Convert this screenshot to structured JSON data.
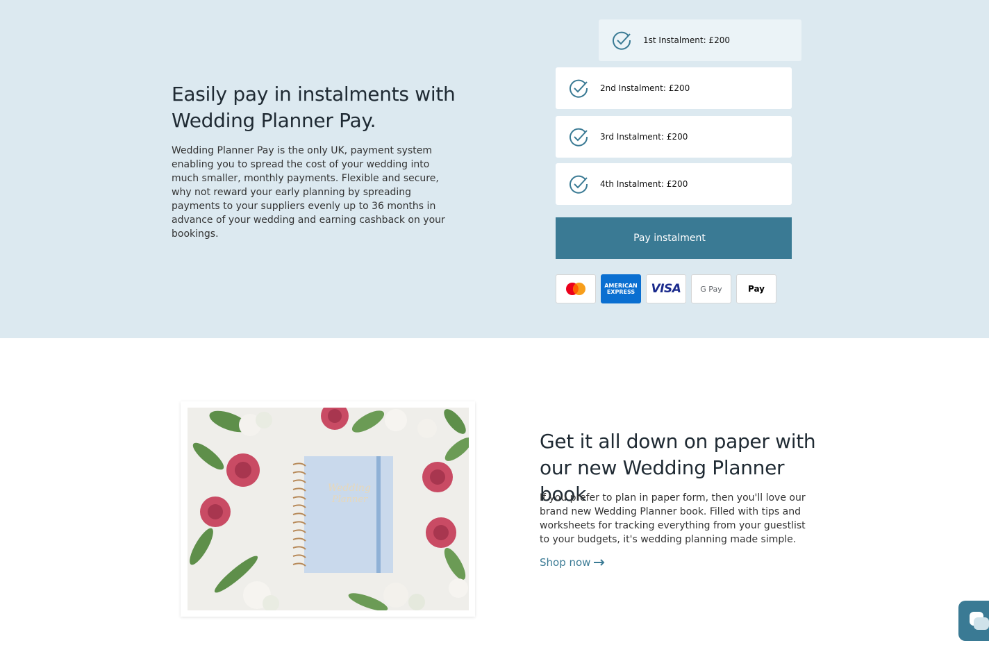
{
  "pay_section": {
    "title": "Easily pay in instalments with Wedding Planner Pay.",
    "body": "Wedding Planner Pay is the only UK, payment system enabling you to spread the cost of your wedding into much smaller, monthly payments. Flexible and secure, why not reward your early planning by spreading payments to your suppliers evenly up to 36 months in advance of your wedding and earning cashback on your bookings.",
    "instalments": [
      {
        "label": "1st Instalment: £200"
      },
      {
        "label": "2nd Instalment: £200"
      },
      {
        "label": "3rd Instalment: £200"
      },
      {
        "label": "4th Instalment: £200"
      }
    ],
    "pay_button": "Pay instalment",
    "cards": {
      "amex_line1": "AMERICAN",
      "amex_line2": "EXPRESS",
      "visa": "VISA",
      "gpay": "G Pay",
      "apay": " Pay"
    },
    "accent": "#3a7a94",
    "bg": "#dce9f0"
  },
  "book_section": {
    "title": "Get it all down on paper with our new Wedding Planner book",
    "body": "If you prefer to plan in paper form, then you'll love our brand new Wedding Planner book. Filled with tips and worksheets for tracking everything from your guestlist to your budgets, it's wedding planning made simple.",
    "link": "Shop now",
    "notebook_line1": "Wedding",
    "notebook_line2": "Planner"
  },
  "chat": {
    "icon": "chat-icon"
  }
}
